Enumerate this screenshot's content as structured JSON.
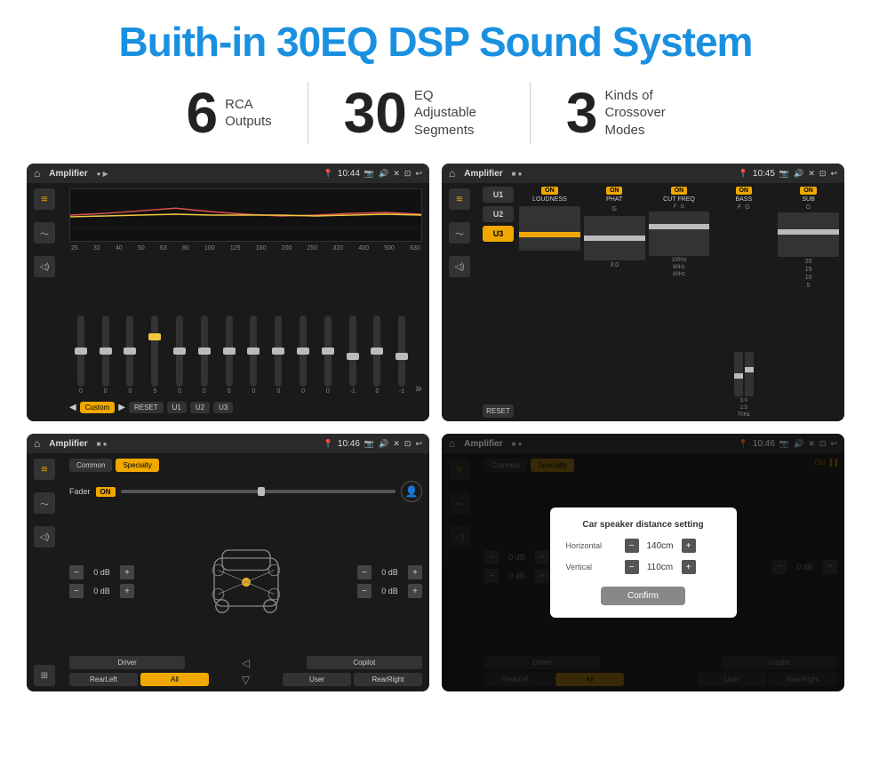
{
  "header": {
    "title": "Buith-in 30EQ DSP Sound System"
  },
  "stats": [
    {
      "number": "6",
      "label_line1": "RCA",
      "label_line2": "Outputs"
    },
    {
      "number": "30",
      "label_line1": "EQ Adjustable",
      "label_line2": "Segments"
    },
    {
      "number": "3",
      "label_line1": "Kinds of",
      "label_line2": "Crossover Modes"
    }
  ],
  "screens": [
    {
      "id": "eq-screen",
      "topbar": {
        "title": "Amplifier",
        "time": "10:44"
      },
      "eq_frequencies": [
        "25",
        "32",
        "40",
        "50",
        "63",
        "80",
        "100",
        "125",
        "160",
        "200",
        "250",
        "320",
        "400",
        "500",
        "630"
      ],
      "eq_values": [
        "0",
        "0",
        "0",
        "5",
        "0",
        "0",
        "0",
        "0",
        "0",
        "0",
        "0",
        "-1",
        "0",
        "-1"
      ],
      "bottom_buttons": [
        "Custom",
        "RESET",
        "U1",
        "U2",
        "U3"
      ]
    },
    {
      "id": "amp-screen",
      "topbar": {
        "title": "Amplifier",
        "time": "10:45"
      },
      "presets": [
        "U1",
        "U2",
        "U3"
      ],
      "channels": [
        "LOUDNESS",
        "PHAT",
        "CUT FREQ",
        "BASS",
        "SUB"
      ]
    },
    {
      "id": "crossover-screen",
      "topbar": {
        "title": "Amplifier",
        "time": "10:46"
      },
      "tabs": [
        "Common",
        "Specialty"
      ],
      "fader_label": "Fader",
      "bottom_buttons": [
        "Driver",
        "",
        "",
        "",
        "",
        "Copilot",
        "RearLeft",
        "All",
        "",
        "User",
        "RearRight"
      ],
      "db_values": [
        "0 dB",
        "0 dB",
        "0 dB",
        "0 dB"
      ]
    },
    {
      "id": "dialog-screen",
      "topbar": {
        "title": "Amplifier",
        "time": "10:46"
      },
      "dialog": {
        "title": "Car speaker distance setting",
        "horizontal_label": "Horizontal",
        "horizontal_value": "140cm",
        "vertical_label": "Vertical",
        "vertical_value": "110cm",
        "confirm_label": "Confirm"
      }
    }
  ]
}
